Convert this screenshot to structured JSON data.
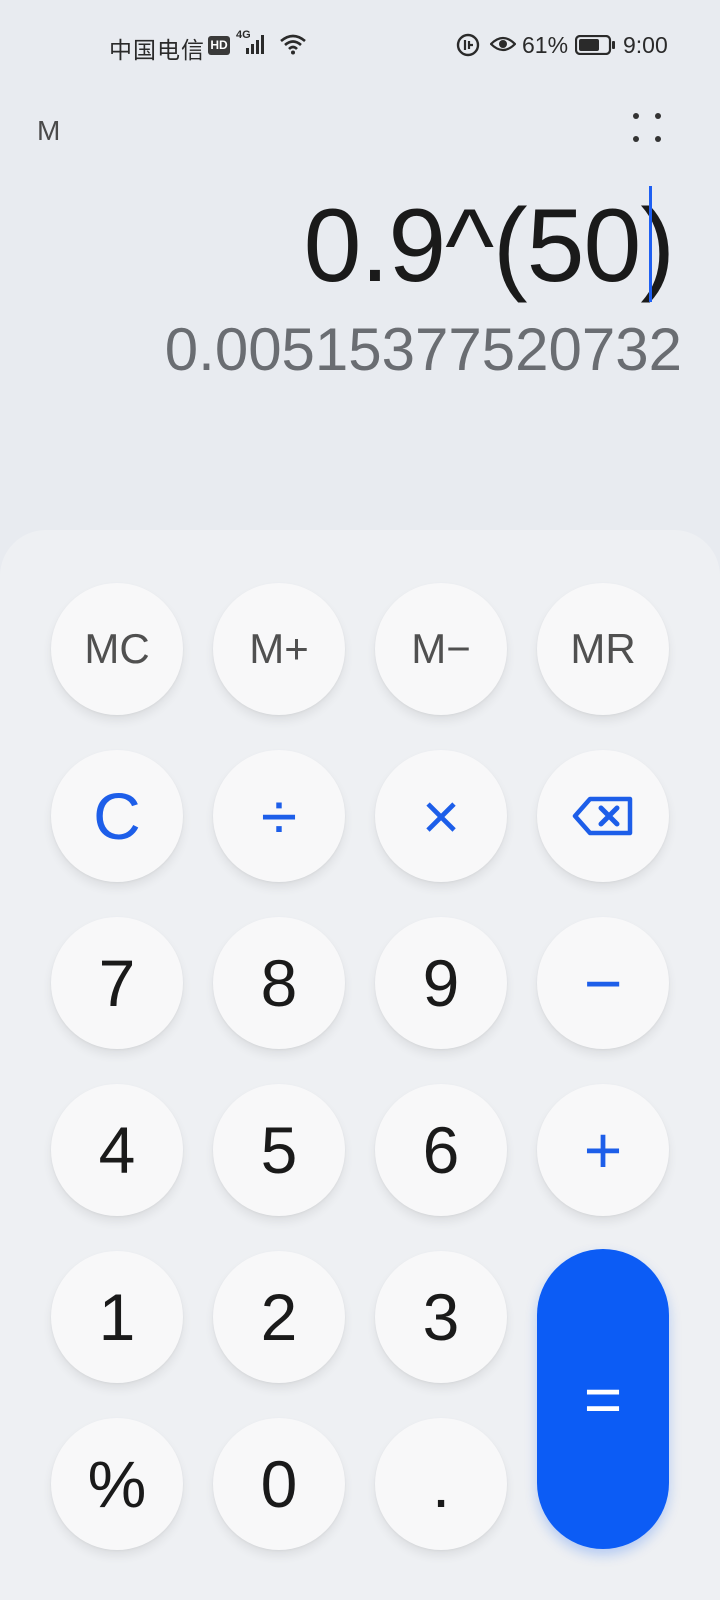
{
  "status_bar": {
    "carrier": "中国电信",
    "hd_badge": "HD",
    "network": "4G",
    "battery_percent": "61%",
    "time": "9:00",
    "icons": [
      "signal-icon",
      "wifi-icon",
      "sync-icon",
      "eye-icon",
      "battery-icon"
    ]
  },
  "header": {
    "memory_indicator": "M",
    "menu_icon": "more-options-icon"
  },
  "display": {
    "expression": "0.9^(50)",
    "result": "0.00515377520732"
  },
  "keypad": {
    "row1": [
      "MC",
      "M+",
      "M−",
      "MR"
    ],
    "row2": [
      "C",
      "÷",
      "×",
      "backspace"
    ],
    "row3": [
      "7",
      "8",
      "9",
      "−"
    ],
    "row4": [
      "4",
      "5",
      "6",
      "+"
    ],
    "row5": [
      "1",
      "2",
      "3"
    ],
    "row6": [
      "%",
      "0",
      "."
    ],
    "equals": "="
  },
  "colors": {
    "accent": "#1d5ee9",
    "equals_bg": "#0c5cf5",
    "background": "#e8ebf0",
    "keypad_bg": "#eef0f3",
    "key_bg": "#f8f8f9"
  }
}
